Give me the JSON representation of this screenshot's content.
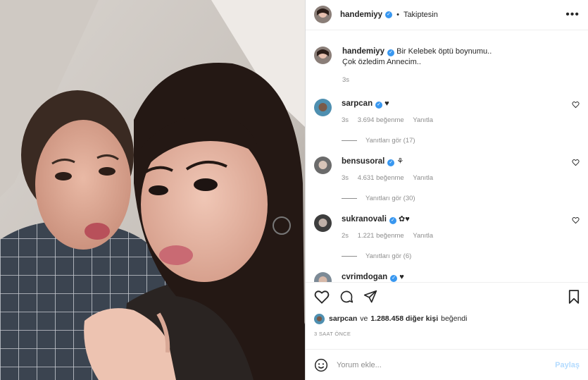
{
  "post": {
    "author": "handemiyy",
    "follow_status": "Takiptesin",
    "caption_line1": "Bir Kelebek öptü boynumu..",
    "caption_line2": "Çok özledim Annecim..",
    "caption_time": "3s"
  },
  "comments": [
    {
      "user": "sarpcan",
      "text": "♥",
      "time": "3s",
      "likes": "3.694 beğenme",
      "reply": "Yanıtla",
      "view_replies": "Yanıtları gör (17)"
    },
    {
      "user": "bensusoral",
      "text": "⚘",
      "time": "3s",
      "likes": "4.631 beğenme",
      "reply": "Yanıtla",
      "view_replies": "Yanıtları gör (30)"
    },
    {
      "user": "sukranovali",
      "text": "✿♥",
      "time": "2s",
      "likes": "1.221 beğenme",
      "reply": "Yanıtla",
      "view_replies": "Yanıtları gör (6)"
    },
    {
      "user": "cvrimdogan",
      "text": "♥"
    }
  ],
  "likes_bar": {
    "user": "sarpcan",
    "joiner": "ve",
    "count_text": "1.288.458 diğer kişi",
    "suffix": "beğendi"
  },
  "timestamp": "3 SAAT ÖNCE",
  "add_comment": {
    "placeholder": "Yorum ekle...",
    "share_label": "Paylaş"
  },
  "icons": {
    "more": "more-icon",
    "like": "heart-icon",
    "comment": "comment-icon",
    "share": "send-icon",
    "save": "bookmark-icon",
    "emoji": "emoji-icon",
    "verified": "verified-icon"
  },
  "colors": {
    "verified": "#3897f0",
    "muted": "#8e8e8e",
    "share_disabled": "#b3dbff"
  }
}
